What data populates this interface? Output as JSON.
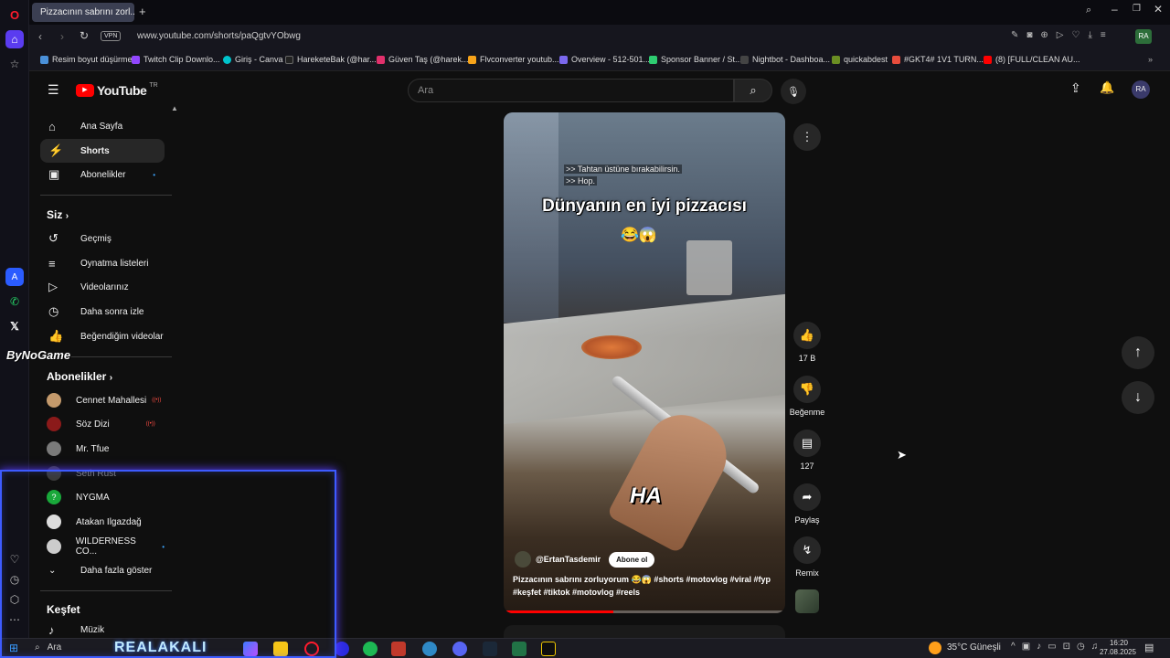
{
  "browser": {
    "tab_title": "Pizzacının sabrını zorl...",
    "url": "www.youtube.com/shorts/paQgtvYObwg",
    "vpn_label": "VPN",
    "bookmarks": [
      {
        "label": "Resim boyut düşürme",
        "color": "#4a90d9"
      },
      {
        "label": "Twitch Clip Downlo...",
        "color": "#9146ff"
      },
      {
        "label": "Giriş - Canva",
        "color": "#00c4cc"
      },
      {
        "label": "HareketeBak (@har...",
        "color": "#222222"
      },
      {
        "label": "Güven Taş (@harek...",
        "color": "#e1306c"
      },
      {
        "label": "Flvconverter youtub...",
        "color": "#f6a31a"
      },
      {
        "label": "Overview - 512-501...",
        "color": "#7b68ee"
      },
      {
        "label": "Sponsor Banner / St...",
        "color": "#2ecc71"
      },
      {
        "label": "Nightbot - Dashboa...",
        "color": "#444444"
      },
      {
        "label": "quickabdest",
        "color": "#6b8e23"
      },
      {
        "label": "#GKT4# 1V1 TURN...",
        "color": "#e74c3c"
      },
      {
        "label": "(8) [FULL/CLEAN AU...",
        "color": "#ff0000"
      }
    ]
  },
  "youtube": {
    "logo": "YouTube",
    "region": "TR",
    "search_placeholder": "Ara",
    "sidebar": {
      "main": [
        {
          "label": "Ana Sayfa",
          "icon": "home-icon",
          "glyph": "⌂"
        },
        {
          "label": "Shorts",
          "icon": "shorts-icon",
          "glyph": "⚡"
        },
        {
          "label": "Abonelikler",
          "icon": "subscriptions-icon",
          "glyph": "▣"
        }
      ],
      "you_heading": "Siz",
      "you": [
        {
          "label": "Geçmiş",
          "icon": "history-icon",
          "glyph": "↺"
        },
        {
          "label": "Oynatma listeleri",
          "icon": "playlist-icon",
          "glyph": "≡"
        },
        {
          "label": "Videolarınız",
          "icon": "your-videos-icon",
          "glyph": "▷"
        },
        {
          "label": "Daha sonra izle",
          "icon": "watch-later-icon",
          "glyph": "◷"
        },
        {
          "label": "Beğendiğim videolar",
          "icon": "liked-videos-icon",
          "glyph": "👍"
        }
      ],
      "subs_heading": "Abonelikler",
      "subs": [
        {
          "label": "Cennet Mahallesi",
          "color": "#c49a6c",
          "badge": "((•))"
        },
        {
          "label": "Söz Dizi",
          "color": "#8b1a1a",
          "badge": "((•))"
        },
        {
          "label": "Mr. Tfue",
          "color": "#7a7a7a",
          "badge": ""
        },
        {
          "label": "Seth Rust",
          "color": "#666666",
          "badge": ""
        },
        {
          "label": "NYGMA",
          "color": "#19a83a",
          "badge": ""
        },
        {
          "label": "Atakan Ilgazdağ",
          "color": "#dddddd",
          "badge": ""
        },
        {
          "label": "WILDERNESS CO...",
          "color": "#cccccc",
          "badge": "•"
        }
      ],
      "show_more": "Daha fazla göster",
      "explore_heading": "Keşfet",
      "explore": [
        {
          "label": "Müzik",
          "icon": "music-icon"
        }
      ]
    },
    "short": {
      "caption_overlay_1": ">> Tahtan üstüne bırakabilirsin.",
      "caption_overlay_2": ">> Hop.",
      "title_overlay": "Dünyanın en iyi pizzacısı",
      "emoji_overlay": "😂😱",
      "ha_overlay": "HA",
      "channel": "@ErtanTasdemir",
      "subscribe": "Abone ol",
      "description_1": "Pizzacının sabrını zorluyorum 😂😱 #shorts #motovlog #viral #fyp",
      "description_2": "#keşfet #tiktok #motovlog #reels",
      "progress": 0.39
    },
    "actions": {
      "likes": "17 B",
      "dislike": "Beğenme",
      "comments": "127",
      "share": "Paylaş",
      "remix": "Remix"
    }
  },
  "overlay_watermark": "ByNoGame",
  "taskbar": {
    "search": "Ara",
    "weather": "35°C",
    "weather_desc": "Güneşli",
    "time": "16:20",
    "date": "27.08.2025",
    "stream_text": "REALAKALI"
  }
}
